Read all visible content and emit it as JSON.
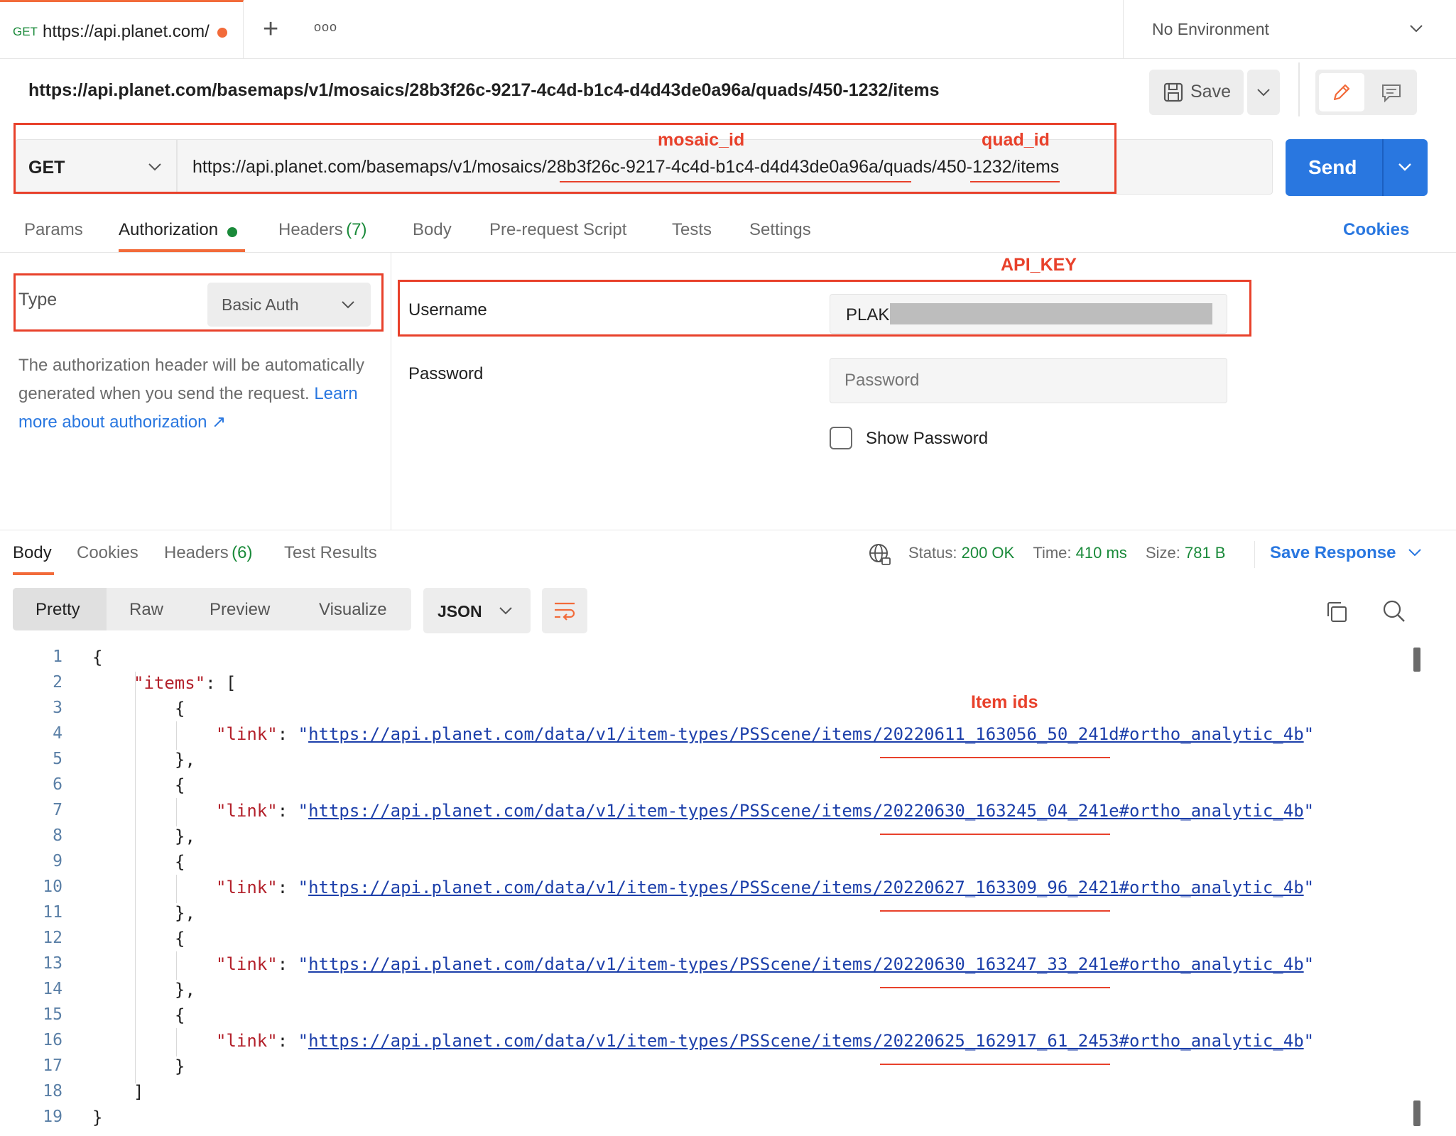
{
  "tab": {
    "method": "GET",
    "url": "https://api.planet.com/"
  },
  "environment": "No Environment",
  "request_title": "https://api.planet.com/basemaps/v1/mosaics/28b3f26c-9217-4c4d-b1c4-d4d43de0a96a/quads/450-1232/items",
  "save_label": "Save",
  "method": "GET",
  "url_parts": {
    "prefix": "https://api.planet.com/basemaps/v1/mosaics/",
    "mosaic": "28b3f26c-9217-4c4d-b1c4-d4d43de0a96a",
    "mid": "/quads/",
    "quad": "450-1232",
    "suffix": "/items"
  },
  "send_label": "Send",
  "annotations": {
    "mosaic_id": "mosaic_id",
    "quad_id": "quad_id",
    "api_key": "API_KEY",
    "item_ids": "Item ids"
  },
  "request_tabs": [
    {
      "label": "Params"
    },
    {
      "label": "Authorization"
    },
    {
      "label": "Headers",
      "count": "(7)"
    },
    {
      "label": "Body"
    },
    {
      "label": "Pre-request Script"
    },
    {
      "label": "Tests"
    },
    {
      "label": "Settings"
    }
  ],
  "cookies_link": "Cookies",
  "auth": {
    "type_label": "Type",
    "type_value": "Basic Auth",
    "description": "The authorization header will be automatically generated when you send the request.",
    "learn_more": "Learn more about authorization ↗",
    "username_label": "Username",
    "username_value": "PLAK",
    "password_label": "Password",
    "password_placeholder": "Password",
    "show_password": "Show Password"
  },
  "response_tabs": [
    {
      "label": "Body"
    },
    {
      "label": "Cookies"
    },
    {
      "label": "Headers",
      "count": "(6)"
    },
    {
      "label": "Test Results"
    }
  ],
  "status": {
    "status_label": "Status:",
    "status_value": "200 OK",
    "time_label": "Time:",
    "time_value": "410 ms",
    "size_label": "Size:",
    "size_value": "781 B"
  },
  "save_response": "Save Response",
  "view_modes": [
    "Pretty",
    "Raw",
    "Preview",
    "Visualize"
  ],
  "format": "JSON",
  "json": {
    "open": "{",
    "items_key": "\"items\"",
    "colon_bracket": ": [",
    "item_open": "{",
    "item_close_comma": "},",
    "item_close": "}",
    "link_key": "\"link\"",
    "colon": ": ",
    "quote": "\"",
    "array_close": "]",
    "close": "}",
    "links": [
      "https://api.planet.com/data/v1/item-types/PSScene/items/20220611_163056_50_241d#ortho_analytic_4b",
      "https://api.planet.com/data/v1/item-types/PSScene/items/20220630_163245_04_241e#ortho_analytic_4b",
      "https://api.planet.com/data/v1/item-types/PSScene/items/20220627_163309_96_2421#ortho_analytic_4b",
      "https://api.planet.com/data/v1/item-types/PSScene/items/20220630_163247_33_241e#ortho_analytic_4b",
      "https://api.planet.com/data/v1/item-types/PSScene/items/20220625_162917_61_2453#ortho_analytic_4b"
    ]
  },
  "line_numbers": [
    "1",
    "2",
    "3",
    "4",
    "5",
    "6",
    "7",
    "8",
    "9",
    "10",
    "11",
    "12",
    "13",
    "14",
    "15",
    "16",
    "17",
    "18",
    "19"
  ],
  "colors": {
    "accent": "#2977e0",
    "orange": "#f26b3a",
    "annotation": "#e8412b",
    "success": "#1a8a3a",
    "status_green": "#1a8a3a"
  }
}
